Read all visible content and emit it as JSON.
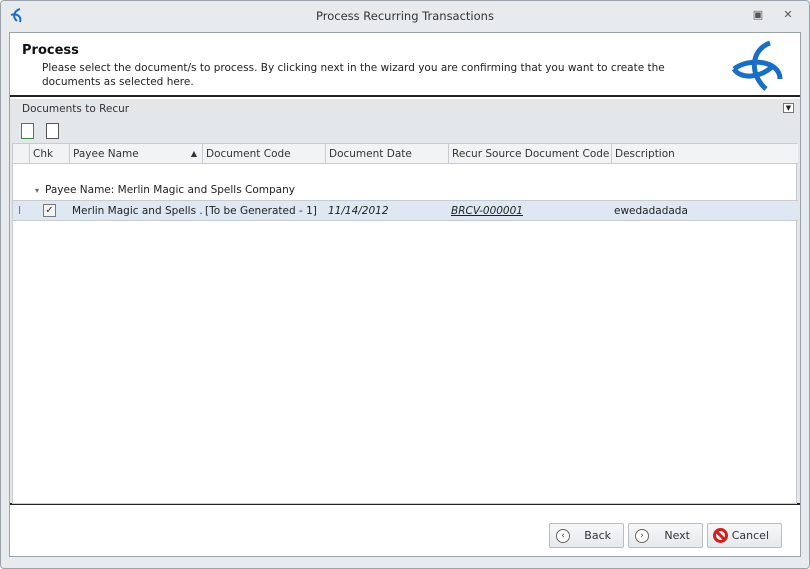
{
  "window": {
    "title": "Process Recurring Transactions"
  },
  "header": {
    "title": "Process",
    "description": "Please select the document/s to process. By clicking next in the wizard you are confirming that you want to create the documents as selected here."
  },
  "group_panel": {
    "title": "Documents to Recur"
  },
  "grid": {
    "columns": [
      "Chk",
      "Payee Name",
      "Document Code",
      "Document Date",
      "Recur Source Document Code",
      "Description"
    ],
    "group_label": "Payee Name: Merlin Magic and Spells Company",
    "rows": [
      {
        "checked": true,
        "payee": "Merlin Magic and Spells ...",
        "doc_code": "[To be Generated - 1]",
        "doc_date": "11/14/2012",
        "source_code": "BRCV-000001",
        "description": "ewedadadada"
      }
    ]
  },
  "footer": {
    "back": "Back",
    "next": "Next",
    "cancel": "Cancel"
  }
}
